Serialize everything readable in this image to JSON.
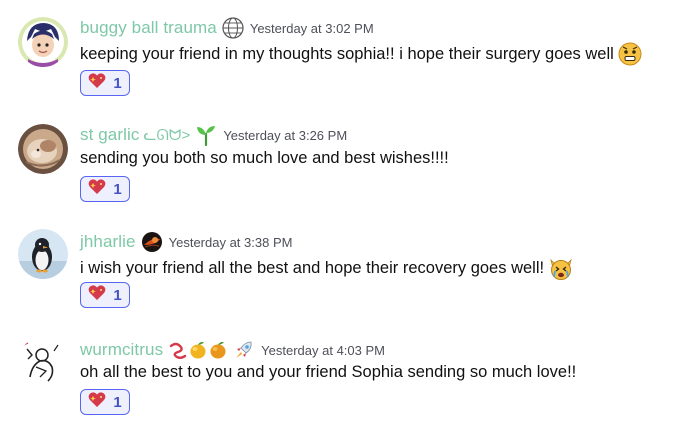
{
  "messages": [
    {
      "username": "buggy ball trauma",
      "timestamp": "Yesterday at 3:02 PM",
      "content": "keeping your friend in my thoughts sophia!! i hope their surgery goes well",
      "reaction": {
        "emoji": "heart-sparkle",
        "count": "1"
      }
    },
    {
      "username": "st garlic",
      "username_suffix": "ᓚᘏᗢ>",
      "timestamp": "Yesterday at 3:26 PM",
      "content": "sending you both so much love and best wishes!!!!",
      "reaction": {
        "emoji": "heart-sparkle",
        "count": "1"
      }
    },
    {
      "username": "jhharlie",
      "timestamp": "Yesterday at 3:38 PM",
      "content": "i wish your friend all the best and hope their recovery goes well!",
      "reaction": {
        "emoji": "heart-sparkle",
        "count": "1"
      }
    },
    {
      "username": "wurmcitrus",
      "timestamp": "Yesterday at 4:03 PM",
      "content": "oh all the best to you and your friend Sophia sending so much love!!",
      "reaction": {
        "emoji": "heart-sparkle",
        "count": "1"
      }
    }
  ],
  "colors": {
    "username": "#7ec8a7",
    "timestamp": "#4e5058",
    "reaction_border": "#5865f2",
    "reaction_bg": "#eef0fe"
  }
}
